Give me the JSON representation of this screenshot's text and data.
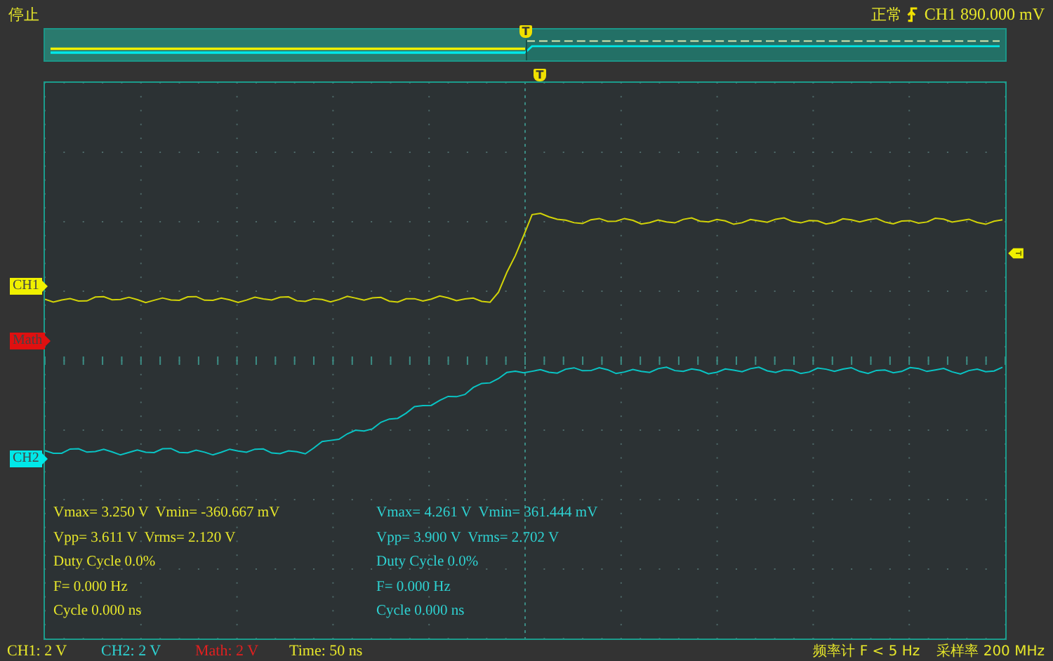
{
  "status": "停止",
  "trigger": {
    "mode": "正常",
    "source_level": "CH1 890.000 mV"
  },
  "overview": {
    "trigger_label": "T"
  },
  "plot": {
    "trigger_label": "T"
  },
  "channel_markers": [
    {
      "label": "CH1",
      "color": "#f0f000"
    },
    {
      "label": "Math",
      "color": "#e01010"
    },
    {
      "label": "CH2",
      "color": "#00e8e8"
    }
  ],
  "measurements": [
    {
      "color": "#e6e62a",
      "lines": [
        "Vmax= 3.250 V  Vmin= -360.667 mV",
        "Vpp= 3.611 V  Vrms= 2.120 V",
        "Duty Cycle 0.0%",
        "F= 0.000 Hz",
        "Cycle 0.000 ns"
      ]
    },
    {
      "color": "#2ed2d2",
      "lines": [
        "Vmax= 4.261 V  Vmin= 361.444 mV",
        "Vpp= 3.900 V  Vrms= 2.702 V",
        "Duty Cycle 0.0%",
        "F= 0.000 Hz",
        "Cycle 0.000 ns"
      ]
    }
  ],
  "scales": [
    {
      "text": "CH1: 2 V",
      "color": "#e6e62a"
    },
    {
      "text": "CH2: 2 V",
      "color": "#2ed2d2"
    },
    {
      "text": "Math: 2 V",
      "color": "#e02020"
    },
    {
      "text": "Time: 50 ns",
      "color": "#e6e62a"
    }
  ],
  "counter": "频率计 F < 5 Hz",
  "sample_rate": "采样率 200 MHz"
}
